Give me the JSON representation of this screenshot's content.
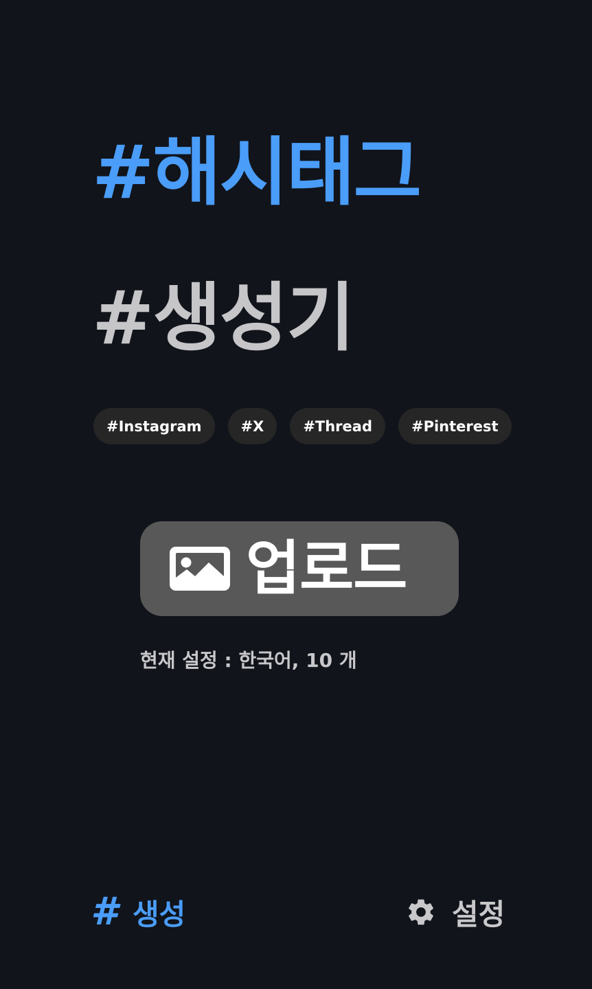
{
  "header": {
    "title_line1": "#해시태그",
    "title_line2": "#생성기"
  },
  "platform_chips": [
    {
      "label": "#Instagram"
    },
    {
      "label": "#X"
    },
    {
      "label": "#Thread"
    },
    {
      "label": "#Pinterest"
    }
  ],
  "upload": {
    "label": "업로드",
    "icon": "image-icon"
  },
  "status": {
    "text": "현재 설정 : 한국어, 10 개"
  },
  "bottom_nav": {
    "generate": {
      "label": "생성",
      "icon": "hash-icon",
      "active": true
    },
    "settings": {
      "label": "설정",
      "icon": "gear-icon",
      "active": false
    }
  },
  "colors": {
    "background": "#11141b",
    "accent": "#4a9df8",
    "chip_bg": "#262626",
    "button_bg": "#585858",
    "muted_text": "#c8c8ca"
  }
}
